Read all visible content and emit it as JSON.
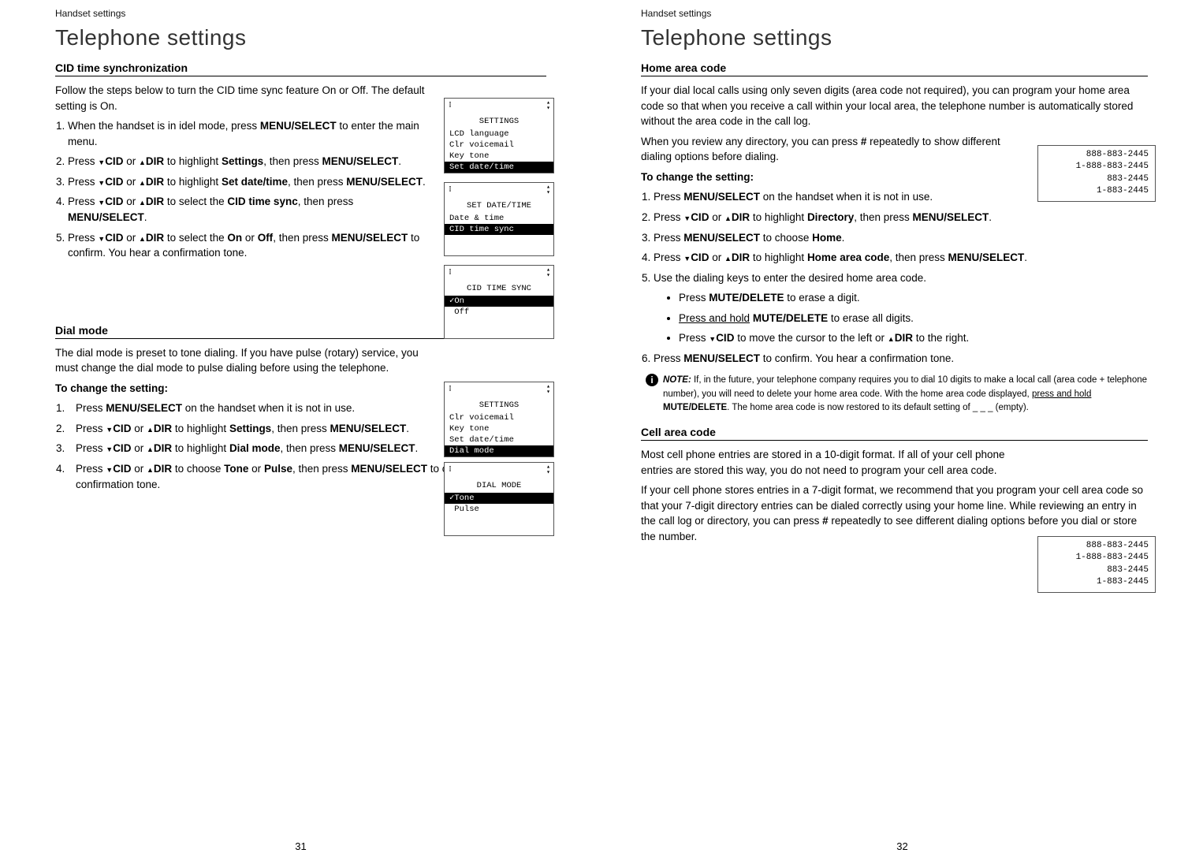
{
  "left": {
    "bread": "Handset settings",
    "h1": "Telephone settings",
    "sec1_h": "CID time synchronization",
    "sec1_p": "Follow the steps below to turn the CID time sync feature On or Off. The default setting is On.",
    "sec1_li1a": "When the handset is in idel mode, press ",
    "sec1_li1b": "MENU/",
    "sec1_li1c": "SELECT",
    "sec1_li1d": " to enter the main menu.",
    "sec1_li2a": "Press ",
    "sec1_li2b": "CID",
    "sec1_li2c": " or ",
    "sec1_li2d": "DIR",
    "sec1_li2e": " to highlight ",
    "sec1_li2f": "Settings",
    "sec1_li2g": ", then press ",
    "sec1_li2h": "MENU",
    "sec1_li2i": "/SELECT",
    "sec1_li2j": ".",
    "sec1_li3a": "Press ",
    "sec1_li3f": "Set date/time",
    "sec1_li3g": ", then press ",
    "sec1_li4f": "CID time sync",
    "sec1_li5f": "On",
    "sec1_li5g": " or ",
    "sec1_li5h": "Off",
    "sec1_li5i": ", then press ",
    "sec1_li5j": "MENU",
    "sec1_li5k": "/SELECT",
    "sec1_li5l": " to confirm. You hear a confirmation tone.",
    "sec2_h": "Dial mode",
    "sec2_p": "The dial mode is preset to tone dialing. If you have pulse (rotary) service, you must change the dial mode to pulse dialing before using the telephone.",
    "sec2_sub": "To change the setting:",
    "sec2_li1a": "Press ",
    "sec2_li1b": "MENU/",
    "sec2_li1c": "SELECT",
    "sec2_li1d": " on the handset when it is not in use.",
    "sec2_li3f": "Dial mode",
    "sec2_li4a": "Press ",
    "sec2_li4f": "Tone",
    "sec2_li4g": " or ",
    "sec2_li4h": "Pulse",
    "sec2_li4i": ", then press ",
    "sec2_li4l": " to confirm. You hear a confirmation tone.",
    "page_num": "31",
    "lcd1": {
      "title": "SETTINGS",
      "r1": "LCD language",
      "r2": "Clr voicemail",
      "r3": "Key tone",
      "sel": "Set date/time"
    },
    "lcd2": {
      "title": "SET DATE/TIME",
      "r1": "Date & time",
      "sel": "CID time sync"
    },
    "lcd3": {
      "title": "CID TIME SYNC",
      "sel": "✓On",
      "r1": " Off"
    },
    "lcd4": {
      "title": "SETTINGS",
      "r1": "Clr voicemail",
      "r2": "Key tone",
      "r3": "Set date/time",
      "sel": "Dial mode"
    },
    "lcd5": {
      "title": "DIAL MODE",
      "sel": "✓Tone",
      "r1": " Pulse"
    }
  },
  "right": {
    "bread": "Handset settings",
    "h1": "Telephone settings",
    "sec1_h": "Home area code",
    "sec1_p1": "If your dial local calls using only seven digits (area code not required), you can program your home area code so that when you receive a call within your local area, the telephone number is automatically stored without the area code in the call log.",
    "sec1_p2a": "When you review any directory, you can press ",
    "sec1_p2b": "#",
    "sec1_p2c": " repeatedly to show different dialing options before dialing.",
    "sec1_sub": "To change the setting:",
    "li1a": "Press ",
    "li1b": "MENU/",
    "li1c": "SELECT",
    "li1d": " on the handset when it is not in use.",
    "li2a": "Press ",
    "li2_cid": "CID",
    "li2_or": " or ",
    "li2_dir": "DIR",
    "li2e": " to highlight ",
    "li2f": "Directory",
    "li2g": ", then press ",
    "li2h": "MENU",
    "li2i": "/SELECT",
    "li2j": ".",
    "li3a": "Press ",
    "li3h": "MENU",
    "li3i": "/SELECT",
    "li3j": " to choose ",
    "li3k": "Home",
    "li3l": ".",
    "li4f": "Home area code",
    "li4g": ", then press ",
    "li5": "Use the dialing keys to enter the desired home area code.",
    "b1a": "Press ",
    "b1b": "MUTE",
    "b1c": "/DELETE",
    "b1d": " to erase a digit.",
    "b2a": "Press and hold",
    "b2b": " ",
    "b2c": "MUTE",
    "b2d": "/DELETE",
    "b2e": " to erase all digits.",
    "b3a": "Press ",
    "b3_cid": "CID",
    "b3c": " to move the cursor to the left or ",
    "b3_dir": "DIR",
    "b3e": " to the right.",
    "li6a": "Press ",
    "li6h": "MENU",
    "li6i": "/SELECT",
    "li6j": " to confirm. You hear a confirmation tone.",
    "note_label": "NOTE:",
    "note1": " If, in the future, your telephone company requires you to dial 10 digits to make a local call (area code + telephone number), you will need to delete your home area code. With the home area code displayed, ",
    "note2": "press and hold",
    "note3": " ",
    "note4": "MUTE",
    "note5": "/DELETE",
    "note6": ". The home area code is now restored to its default setting of _ _ _ (empty).",
    "sec2_h": "Cell area code",
    "sec2_p1": "Most cell phone entries are stored in a 10-digit format. If all of your cell phone entries are stored this way, you do not need to program your cell area code.",
    "sec2_p2a": "If your cell phone stores entries in a 7-digit format, we recommend that you program your cell area code so that your 7-digit directory entries can be dialed correctly using your home line. While reviewing an entry in the call log or directory, you can press ",
    "sec2_p2b": "#",
    "sec2_p2c": " repeatedly to see different dialing options before you dial or store the number.",
    "page_num": "32",
    "dial": {
      "l1": "888-883-2445",
      "l2": "1-888-883-2445",
      "l3": "883-2445",
      "l4": "1-883-2445"
    }
  }
}
